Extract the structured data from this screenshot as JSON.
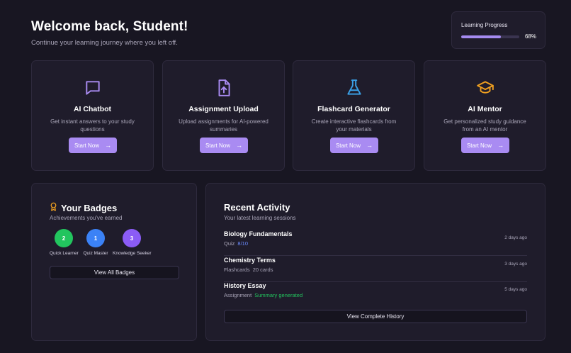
{
  "header": {
    "welcome": "Welcome back, Student!",
    "subtitle": "Continue your learning journey where you left off."
  },
  "progress": {
    "label": "Learning Progress",
    "value": 68,
    "display": "68%",
    "fill_color": "#a58bf0"
  },
  "features": [
    {
      "title": "AI Chatbot",
      "desc": "Get instant answers to your study questions",
      "button": "Start Now",
      "icon": "chat-bubble-icon",
      "icon_color": "#a98bf2"
    },
    {
      "title": "Assignment Upload",
      "desc": "Upload assignments for AI-powered summaries",
      "button": "Start Now",
      "icon": "file-upload-icon",
      "icon_color": "#a98bf2"
    },
    {
      "title": "Flashcard Generator",
      "desc": "Create interactive flashcards from your materials",
      "button": "Start Now",
      "icon": "flask-icon",
      "icon_color": "#3aa0e6"
    },
    {
      "title": "AI Mentor",
      "desc": "Get personalized study guidance from an AI mentor",
      "button": "Start Now",
      "icon": "graduation-cap-icon",
      "icon_color": "#f0a020"
    }
  ],
  "badges": {
    "title": "Your Badges",
    "subtitle": "Achievements you've earned",
    "icon": "award-icon",
    "items": [
      {
        "number": "2",
        "label": "Quick Learner",
        "color": "#22c55e"
      },
      {
        "number": "1",
        "label": "Quiz Master",
        "color": "#3b82f6"
      },
      {
        "number": "3",
        "label": "Knowledge Seeker",
        "color": "#8b5cf6"
      }
    ],
    "button": "View All Badges"
  },
  "activity": {
    "title": "Recent Activity",
    "subtitle": "Your latest learning sessions",
    "items": [
      {
        "title": "Biology Fundamentals",
        "type": "Quiz",
        "detail": "8/10",
        "detail_color": "#6b8cff",
        "time": "2 days ago"
      },
      {
        "title": "Chemistry Terms",
        "type": "Flashcards",
        "detail": "20 cards",
        "detail_color": "#a9a5b8",
        "time": "3 days ago"
      },
      {
        "title": "History Essay",
        "type": "Assignment",
        "detail": "Summary generated",
        "detail_color": "#22c55e",
        "time": "5 days ago"
      }
    ],
    "button": "View Complete History"
  }
}
